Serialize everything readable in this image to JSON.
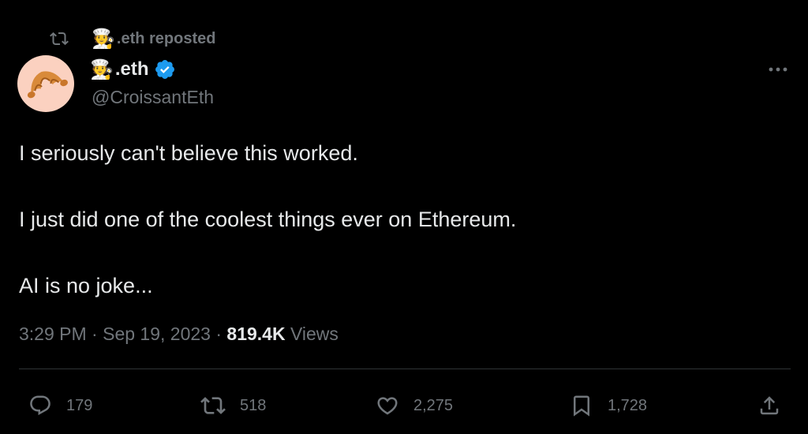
{
  "repost": {
    "text": ".eth reposted",
    "emoji": "🧑‍🍳"
  },
  "author": {
    "display_name": ".eth",
    "emoji": "🧑‍🍳",
    "handle": "@CroissantEth",
    "verified": true,
    "avatar": "croissant"
  },
  "tweet": {
    "paragraphs": [
      "I seriously can't believe this worked.",
      "I just did one of the coolest things ever on Ethereum.",
      "AI is no joke..."
    ]
  },
  "meta": {
    "time": "3:29 PM",
    "date": "Sep 19, 2023",
    "views_count": "819.4K",
    "views_label": "Views",
    "separator": "·"
  },
  "actions": {
    "replies": "179",
    "reposts": "518",
    "likes": "2,275",
    "bookmarks": "1,728"
  },
  "icons": {
    "repost": "repost-icon",
    "verified": "verified-badge-icon",
    "more": "more-icon",
    "reply": "reply-icon",
    "like": "heart-icon",
    "bookmark": "bookmark-icon",
    "share": "share-icon"
  },
  "colors": {
    "background": "#000000",
    "primary_text": "#e7e9ea",
    "secondary_text": "#71767b",
    "verified_blue": "#1d9bf0",
    "divider": "#2f3336"
  }
}
